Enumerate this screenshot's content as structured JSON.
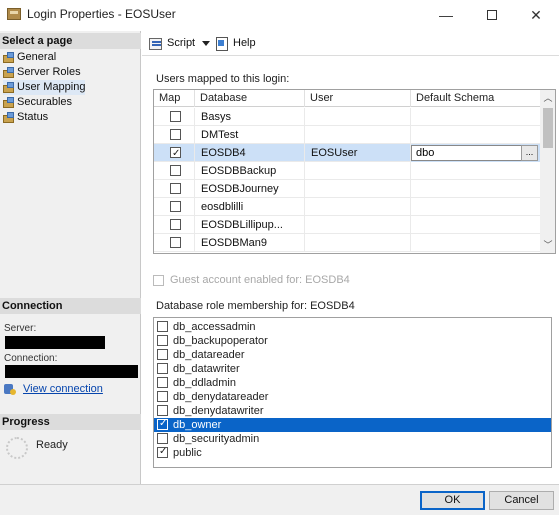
{
  "window": {
    "title": "Login Properties - EOSUser",
    "min_glyph": "—",
    "close_glyph": "✕"
  },
  "sidebar": {
    "select_page_header": "Select a page",
    "pages": [
      {
        "label": "General",
        "selected": false
      },
      {
        "label": "Server Roles",
        "selected": false
      },
      {
        "label": "User Mapping",
        "selected": true
      },
      {
        "label": "Securables",
        "selected": false
      },
      {
        "label": "Status",
        "selected": false
      }
    ],
    "connection_header": "Connection",
    "server_label": "Server:",
    "connection_label": "Connection:",
    "view_connection": "View connection",
    "progress_header": "Progress",
    "progress_status": "Ready"
  },
  "toolbar": {
    "script_label": "Script",
    "help_label": "Help"
  },
  "mapping": {
    "label": "Users mapped to this login:",
    "columns": [
      "Map",
      "Database",
      "User",
      "Default Schema"
    ],
    "rows": [
      {
        "map": false,
        "database": "Basys",
        "user": "",
        "schema": ""
      },
      {
        "map": false,
        "database": "DMTest",
        "user": "",
        "schema": ""
      },
      {
        "map": true,
        "database": "EOSDB4",
        "user": "EOSUser",
        "schema": "dbo"
      },
      {
        "map": false,
        "database": "EOSDBBackup",
        "user": "",
        "schema": ""
      },
      {
        "map": false,
        "database": "EOSDBJourney",
        "user": "",
        "schema": ""
      },
      {
        "map": false,
        "database": "eosdblilli",
        "user": "",
        "schema": ""
      },
      {
        "map": false,
        "database": "EOSDBLillipup...",
        "user": "",
        "schema": ""
      },
      {
        "map": false,
        "database": "EOSDBMan9",
        "user": "",
        "schema": ""
      }
    ],
    "selected_row": 2,
    "ellipsis": "..."
  },
  "guest": {
    "label": "Guest account enabled for: EOSDB4"
  },
  "roles": {
    "label": "Database role membership for: EOSDB4",
    "items": [
      {
        "label": "db_accessadmin",
        "checked": false
      },
      {
        "label": "db_backupoperator",
        "checked": false
      },
      {
        "label": "db_datareader",
        "checked": false
      },
      {
        "label": "db_datawriter",
        "checked": false
      },
      {
        "label": "db_ddladmin",
        "checked": false
      },
      {
        "label": "db_denydatareader",
        "checked": false
      },
      {
        "label": "db_denydatawriter",
        "checked": false
      },
      {
        "label": "db_owner",
        "checked": true
      },
      {
        "label": "db_securityadmin",
        "checked": false
      },
      {
        "label": "public",
        "checked": true
      }
    ],
    "selected_index": 7
  },
  "buttons": {
    "ok": "OK",
    "cancel": "Cancel"
  }
}
